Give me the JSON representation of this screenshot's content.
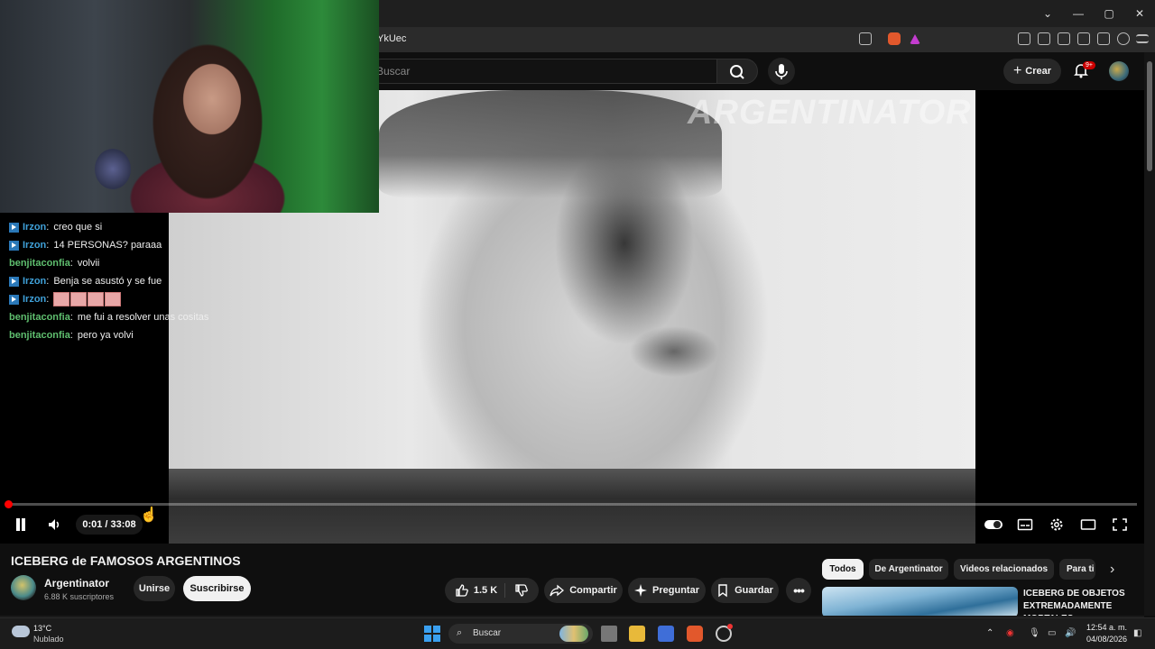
{
  "browser": {
    "url_fragment": "YkUec",
    "window_controls": [
      "⌄",
      "—",
      "▢",
      "✕"
    ]
  },
  "header": {
    "search_placeholder": "Buscar",
    "create_label": "Crear",
    "notification_badge": "9+"
  },
  "video": {
    "watermark": "ARGENTINATOR",
    "time_display": "0:01 / 33:08",
    "progress_fraction": 0.0005
  },
  "chat": {
    "messages": [
      {
        "user": "Irzon",
        "badge": true,
        "text": "creo que si"
      },
      {
        "user": "Irzon",
        "badge": true,
        "text": "14 PERSONAS? paraaa"
      },
      {
        "user": "benjitaconfia",
        "badge": false,
        "text": "volvii"
      },
      {
        "user": "Irzon",
        "badge": true,
        "text": "Benja se asustó y se fue"
      },
      {
        "user": "Irzon",
        "badge": true,
        "text": ""
      },
      {
        "user": "benjitaconfia",
        "badge": false,
        "text": "me fui a resolver unas cositas"
      },
      {
        "user": "benjitaconfia",
        "badge": false,
        "text": "pero ya volvi"
      }
    ]
  },
  "watch": {
    "title": "ICEBERG de FAMOSOS ARGENTINOS",
    "channel_name": "Argentinator",
    "subscribers": "6.88 K suscriptores",
    "join_label": "Unirse",
    "subscribe_label": "Suscribirse",
    "likes": "1.5 K",
    "share_label": "Compartir",
    "ask_label": "Preguntar",
    "save_label": "Guardar"
  },
  "recommendations": {
    "chips": [
      "Todos",
      "De Argentinator",
      "Videos relacionados",
      "Para ti"
    ],
    "first_title": "ICEBERG DE OBJETOS EXTREMADAMENTE MORTALES"
  },
  "taskbar": {
    "weather_temp": "13°C",
    "weather_desc": "Nublado",
    "search_label": "Buscar",
    "time": "12:54 a. m.",
    "date": "04/08/2026"
  },
  "colors": {
    "accent_red": "#ff0000",
    "background": "#0f0f0f",
    "chat_user_blue": "#3fa0d8"
  }
}
